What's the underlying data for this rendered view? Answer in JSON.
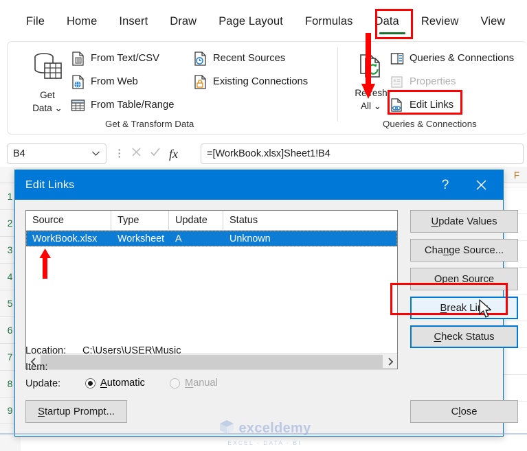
{
  "ribbon": {
    "tabs": [
      {
        "label": "File"
      },
      {
        "label": "Home"
      },
      {
        "label": "Insert"
      },
      {
        "label": "Draw"
      },
      {
        "label": "Page Layout"
      },
      {
        "label": "Formulas"
      },
      {
        "label": "Data"
      },
      {
        "label": "Review"
      },
      {
        "label": "View"
      }
    ],
    "active_tab": "Data",
    "groups": [
      {
        "name": "Get & Transform Data",
        "big_button": {
          "line1": "Get",
          "line2": "Data",
          "icon": "get-data-icon"
        },
        "commands": [
          {
            "label": "From Text/CSV",
            "icon": "text-csv-icon",
            "disabled": false
          },
          {
            "label": "From Web",
            "icon": "web-icon",
            "disabled": false
          },
          {
            "label": "From Table/Range",
            "icon": "table-range-icon",
            "disabled": false
          },
          {
            "label": "Recent Sources",
            "icon": "recent-sources-icon",
            "disabled": false
          },
          {
            "label": "Existing Connections",
            "icon": "existing-connections-icon",
            "disabled": false
          }
        ]
      },
      {
        "name": "Queries & Connections",
        "big_button": {
          "line1": "Refresh",
          "line2": "All",
          "icon": "refresh-all-icon"
        },
        "commands": [
          {
            "label": "Queries & Connections",
            "icon": "queries-connections-icon",
            "disabled": false
          },
          {
            "label": "Properties",
            "icon": "properties-icon",
            "disabled": true
          },
          {
            "label": "Edit Links",
            "icon": "edit-links-icon",
            "disabled": false
          }
        ]
      }
    ]
  },
  "formula_bar": {
    "name_box": "B4",
    "formula": "=[WorkBook.xlsx]Sheet1!B4",
    "cancel_icon": "cancel-icon",
    "enter_icon": "enter-icon",
    "fx_label": "fx"
  },
  "sheet": {
    "row_headers": [
      "1",
      "2",
      "3",
      "4",
      "5",
      "6",
      "7",
      "8",
      "9"
    ],
    "col_headers": [
      "F"
    ]
  },
  "dialog": {
    "title": "Edit Links",
    "help_label": "?",
    "close_label": "close-icon",
    "list": {
      "columns": [
        "Source",
        "Type",
        "Update",
        "Status"
      ],
      "rows": [
        {
          "source": "WorkBook.xlsx",
          "type": "Worksheet",
          "update": "A",
          "status": "Unknown",
          "selected": true
        }
      ],
      "scroll_left_icon": "chevron-left-icon",
      "scroll_right_icon": "chevron-right-icon"
    },
    "side_buttons": [
      {
        "label": "Update Values",
        "accel": "U",
        "state": "normal"
      },
      {
        "label": "Change Source...",
        "accel": "n",
        "state": "normal"
      },
      {
        "label": "Open Source",
        "accel": "O",
        "state": "normal"
      },
      {
        "label": "Break Link",
        "accel": "B",
        "state": "focused"
      },
      {
        "label": "Check Status",
        "accel": "C",
        "state": "default-border"
      }
    ],
    "info": {
      "location_label": "Location:",
      "location_value": "C:\\Users\\USER\\Music",
      "item_label": "Item:",
      "item_value": "",
      "update_label": "Update:",
      "radio_automatic": {
        "label": "Automatic",
        "accel": "A",
        "checked": true,
        "disabled": false
      },
      "radio_manual": {
        "label": "Manual",
        "accel": "M",
        "checked": false,
        "disabled": true
      }
    },
    "bottom_buttons": [
      {
        "label": "Startup Prompt...",
        "accel": "S"
      },
      {
        "label": "Close",
        "accel": "l"
      }
    ]
  },
  "watermark": {
    "text": "exceldemy",
    "tagline": "EXCEL - DATA - BI"
  },
  "annotations": {
    "tab_highlight_color": "#ff0000",
    "edit_links_highlight_color": "#ff0000",
    "break_link_highlight_color": "#ff0000",
    "arrow_color": "#ff0000",
    "accent_blue": "#0078d7",
    "selection_blue": "#0c7cd5",
    "tab_underline_green": "#15712d"
  }
}
